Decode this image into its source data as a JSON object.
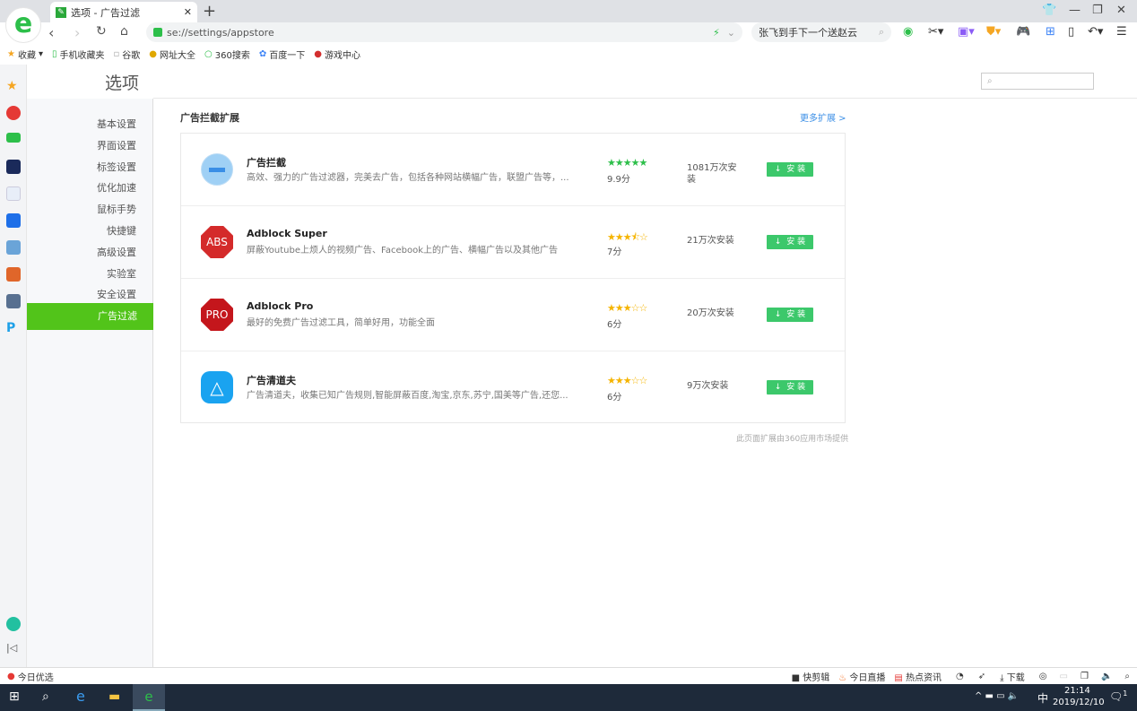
{
  "browser": {
    "tab_title": "选项 - 广告过滤",
    "url": "se://settings/appstore",
    "search_value": "张飞到手下一个送赵云",
    "bookmarks": [
      "收藏",
      "手机收藏夹",
      "谷歌",
      "网址大全",
      "360搜索",
      "百度一下",
      "游戏中心"
    ]
  },
  "page": {
    "title": "选项",
    "search_placeholder": "",
    "sidebar": [
      "基本设置",
      "界面设置",
      "标签设置",
      "优化加速",
      "鼠标手势",
      "快捷键",
      "高级设置",
      "实验室",
      "安全设置",
      "广告过滤"
    ],
    "section_title": "广告拦截扩展",
    "more_link": "更多扩展 >",
    "install_label": "安 装",
    "extensions": [
      {
        "name": "广告拦截",
        "desc": "高效、强力的广告过滤器，完美去广告，包括各种网站横幅广告，联盟广告等，...",
        "rating": 5,
        "score": "9.9分",
        "installs": "1081万次安装",
        "icon": "minus-badge",
        "color": "#9fd0f5"
      },
      {
        "name": "Adblock Super",
        "desc": "屏蔽Youtube上烦人的视频广告、Facebook上的广告、横幅广告以及其他广告",
        "rating": 3.5,
        "score": "7分",
        "installs": "21万次安装",
        "icon": "ABS",
        "color": "#d42a2a"
      },
      {
        "name": "Adblock Pro",
        "desc": "最好的免费广告过滤工具，简单好用，功能全面",
        "rating": 3,
        "score": "6分",
        "installs": "20万次安装",
        "icon": "PRO",
        "color": "#c4161c"
      },
      {
        "name": "广告清道夫",
        "desc": "广告清道夫，收集已知广告规则,智能屏蔽百度,淘宝,京东,苏宁,国美等广告,还您...",
        "rating": 3,
        "score": "6分",
        "installs": "9万次安装",
        "icon": "triangle",
        "color": "#1aa3f0"
      }
    ],
    "credit": "此页面扩展由360应用市场提供"
  },
  "statusbar": {
    "left": "今日优选",
    "items": [
      "快剪辑",
      "今日直播",
      "热点资讯",
      "下载"
    ]
  },
  "taskbar": {
    "time": "21:14",
    "date": "2019/12/10",
    "ime": "中",
    "notifications": "1"
  }
}
